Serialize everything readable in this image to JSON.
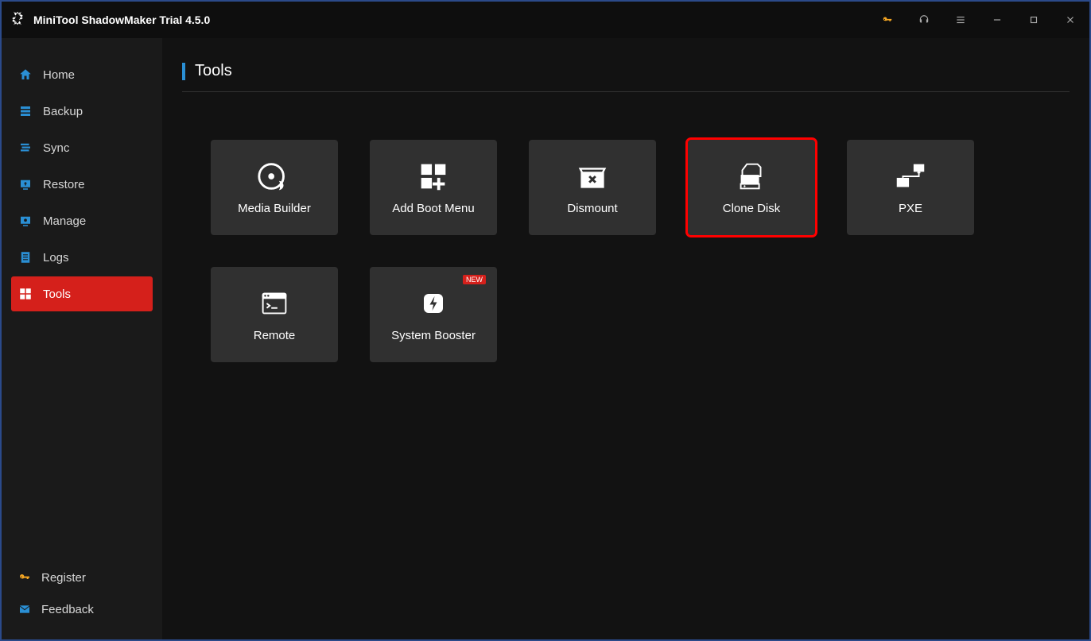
{
  "title": "MiniTool ShadowMaker Trial 4.5.0",
  "sidebar": {
    "items": [
      {
        "label": "Home"
      },
      {
        "label": "Backup"
      },
      {
        "label": "Sync"
      },
      {
        "label": "Restore"
      },
      {
        "label": "Manage"
      },
      {
        "label": "Logs"
      },
      {
        "label": "Tools"
      }
    ],
    "active_index": 6,
    "footer": {
      "register": "Register",
      "feedback": "Feedback"
    }
  },
  "page": {
    "title": "Tools"
  },
  "tools": [
    {
      "label": "Media Builder",
      "highlight": false,
      "new": false
    },
    {
      "label": "Add Boot Menu",
      "highlight": false,
      "new": false
    },
    {
      "label": "Dismount",
      "highlight": false,
      "new": false
    },
    {
      "label": "Clone Disk",
      "highlight": true,
      "new": false
    },
    {
      "label": "PXE",
      "highlight": false,
      "new": false
    },
    {
      "label": "Remote",
      "highlight": false,
      "new": false
    },
    {
      "label": "System Booster",
      "highlight": false,
      "new": true
    }
  ],
  "badges": {
    "new": "NEW"
  },
  "colors": {
    "accent": "#2a8fd4",
    "active": "#d5201b",
    "highlight": "#ff0000",
    "key": "#f5a623"
  }
}
